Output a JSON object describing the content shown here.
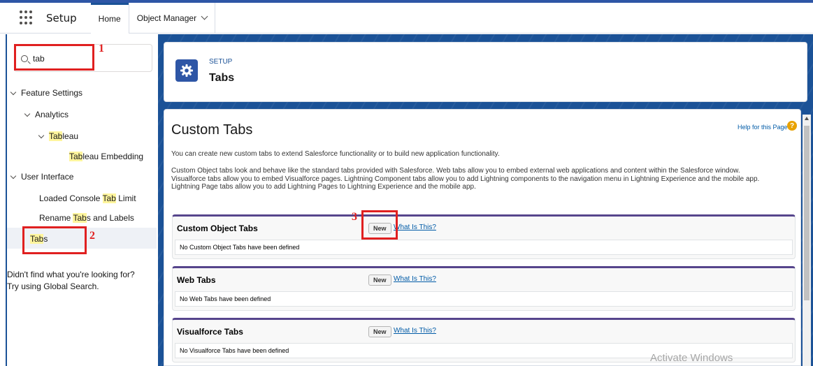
{
  "header": {
    "app_name": "Setup",
    "tabs": [
      {
        "label": "Home",
        "active": true
      },
      {
        "label": "Object Manager",
        "active": false
      }
    ]
  },
  "sidebar": {
    "search_value": "tab",
    "items": {
      "feature_settings": "Feature Settings",
      "analytics": "Analytics",
      "tableau_hl": "Tab",
      "tableau_rest": "leau",
      "tableau_emb_hl": "Tab",
      "tableau_emb_rest": "leau Embedding",
      "user_interface": "User Interface",
      "console_pre": "Loaded Console ",
      "console_hl": "Tab",
      "console_post": " Limit",
      "rename_pre": "Rename ",
      "rename_hl": "Tab",
      "rename_post": "s and Labels",
      "tabs_hl": "Tab",
      "tabs_post": "s"
    },
    "help_line1": "Didn't find what you're looking for?",
    "help_line2": "Try using Global Search."
  },
  "annotations": {
    "n1": "1",
    "n2": "2",
    "n3": "3"
  },
  "setup_header": {
    "eyebrow": "SETUP",
    "title": "Tabs"
  },
  "content": {
    "title": "Custom Tabs",
    "help_link": "Help for this Page",
    "help_badge": "?",
    "para1": "You can create new custom tabs to extend Salesforce functionality or to build new application functionality.",
    "para2a": "Custom Object tabs look and behave like the standard tabs provided with Salesforce. Web tabs allow you to embed external web applications and content within the Salesforce window.",
    "para2b": "Visualforce tabs allow you to embed Visualforce pages. Lightning Component tabs allow you to add Lightning components to the navigation menu in Lightning Experience and the mobile app.",
    "para2c": "Lightning Page tabs allow you to add Lightning Pages to Lightning Experience and the mobile app.",
    "sections": [
      {
        "title": "Custom Object Tabs",
        "new_label": "New",
        "what_label": "What Is This?",
        "empty": "No Custom Object Tabs have been defined"
      },
      {
        "title": "Web Tabs",
        "new_label": "New",
        "what_label": "What Is This?",
        "empty": "No Web Tabs have been defined"
      },
      {
        "title": "Visualforce Tabs",
        "new_label": "New",
        "what_label": "What Is This?",
        "empty": "No Visualforce Tabs have been defined"
      }
    ]
  },
  "watermark": "Activate Windows"
}
